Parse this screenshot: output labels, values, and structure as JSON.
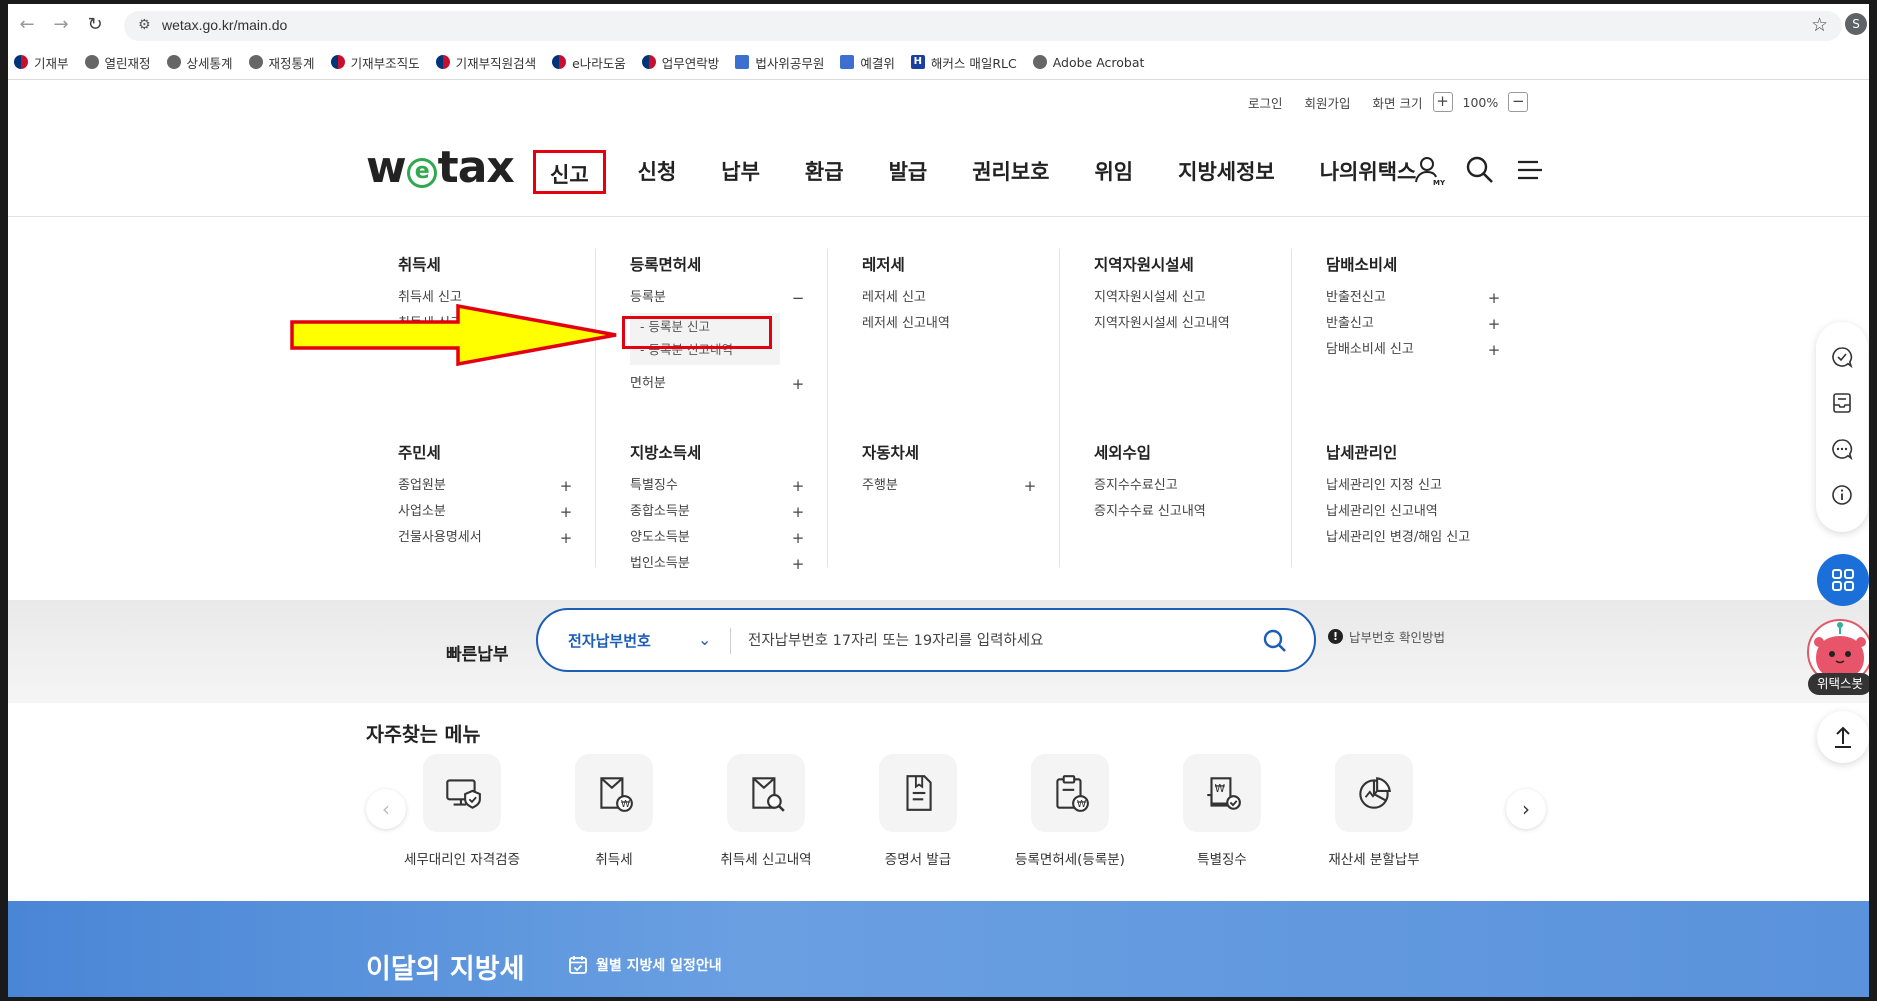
{
  "browser": {
    "url": "wetax.go.kr/main.do",
    "profile_initial": "S",
    "bookmarks": [
      {
        "label": "기재부",
        "icon": "gov-emblem-icon"
      },
      {
        "label": "열린재정",
        "icon": "globe-icon"
      },
      {
        "label": "상세통계",
        "icon": "globe-icon"
      },
      {
        "label": "재정통계",
        "icon": "globe-icon"
      },
      {
        "label": "기재부조직도",
        "icon": "gov-emblem-icon"
      },
      {
        "label": "기재부직원검색",
        "icon": "gov-emblem-icon"
      },
      {
        "label": "e나라도움",
        "icon": "gov-emblem-icon"
      },
      {
        "label": "업무연락방",
        "icon": "gov-emblem-icon"
      },
      {
        "label": "법사위공무원",
        "icon": "building-icon"
      },
      {
        "label": "예결위",
        "icon": "building-icon"
      },
      {
        "label": "해커스 매일RLC",
        "icon": "hackers-icon"
      },
      {
        "label": "Adobe Acrobat",
        "icon": "globe-icon"
      }
    ]
  },
  "util": {
    "login": "로그인",
    "signup": "회원가입",
    "zoom_label": "화면 크기",
    "zoom_plus": "+",
    "zoom_value": "100%",
    "zoom_minus": "−"
  },
  "logo": {
    "w": "w",
    "e": "e",
    "rest": "tax"
  },
  "gnb": [
    "신고",
    "신청",
    "납부",
    "환급",
    "발급",
    "권리보호",
    "위임",
    "지방세정보",
    "나의위택스"
  ],
  "mega": {
    "row1": [
      {
        "title": "취득세",
        "items": [
          {
            "label": "취득세 신고",
            "pm": ""
          },
          {
            "label": "취득세 신고내역",
            "pm": ""
          }
        ]
      },
      {
        "title": "등록면허세",
        "items": [
          {
            "label": "등록분",
            "pm": "−"
          }
        ],
        "sub": [
          "- 등록분 신고",
          "- 등록분 신고내역"
        ],
        "after": [
          {
            "label": "면허분",
            "pm": "+"
          }
        ]
      },
      {
        "title": "레저세",
        "items": [
          {
            "label": "레저세 신고",
            "pm": ""
          },
          {
            "label": "레저세 신고내역",
            "pm": ""
          }
        ]
      },
      {
        "title": "지역자원시설세",
        "items": [
          {
            "label": "지역자원시설세 신고",
            "pm": ""
          },
          {
            "label": "지역자원시설세 신고내역",
            "pm": ""
          }
        ]
      },
      {
        "title": "담배소비세",
        "items": [
          {
            "label": "반출전신고",
            "pm": "+"
          },
          {
            "label": "반출신고",
            "pm": "+"
          },
          {
            "label": "담배소비세 신고",
            "pm": "+"
          }
        ]
      }
    ],
    "row2": [
      {
        "title": "주민세",
        "items": [
          {
            "label": "종업원분",
            "pm": "+"
          },
          {
            "label": "사업소분",
            "pm": "+"
          },
          {
            "label": "건물사용명세서",
            "pm": "+"
          }
        ]
      },
      {
        "title": "지방소득세",
        "items": [
          {
            "label": "특별징수",
            "pm": "+"
          },
          {
            "label": "종합소득분",
            "pm": "+"
          },
          {
            "label": "양도소득분",
            "pm": "+"
          },
          {
            "label": "법인소득분",
            "pm": "+"
          }
        ]
      },
      {
        "title": "자동차세",
        "items": [
          {
            "label": "주행분",
            "pm": "+"
          }
        ]
      },
      {
        "title": "세외수입",
        "items": [
          {
            "label": "증지수수료신고",
            "pm": ""
          },
          {
            "label": "증지수수료 신고내역",
            "pm": ""
          }
        ]
      },
      {
        "title": "납세관리인",
        "items": [
          {
            "label": "납세관리인 지정 신고",
            "pm": ""
          },
          {
            "label": "납세관리인 신고내역",
            "pm": ""
          },
          {
            "label": "납세관리인 변경/해임 신고",
            "pm": ""
          }
        ]
      }
    ]
  },
  "quick_pay": {
    "label": "빠른납부",
    "select": "전자납부번호",
    "placeholder": "전자납부번호 17자리 또는 19자리를 입력하세요",
    "help": "납부번호 확인방법"
  },
  "frequent": {
    "title": "자주찾는 메뉴",
    "items": [
      {
        "label": "세무대리인 자격검증",
        "icon": "monitor-shield-icon"
      },
      {
        "label": "취득세",
        "icon": "document-coin-icon"
      },
      {
        "label": "취득세 신고내역",
        "icon": "document-search-icon"
      },
      {
        "label": "증명서 발급",
        "icon": "certificate-icon"
      },
      {
        "label": "등록면허세(등록분)",
        "icon": "clipboard-coin-icon"
      },
      {
        "label": "특별징수",
        "icon": "invoice-check-icon"
      },
      {
        "label": "재산세 분할납부",
        "icon": "pie-chart-icon"
      }
    ]
  },
  "month": {
    "title": "이달의 지방세",
    "link": "월별 지방세 일정안내"
  },
  "bot_label": "위택스봇",
  "colors": {
    "accent": "#1b5db7",
    "highlight": "#e3000f",
    "arrow_fill": "#ffff00",
    "brand_green": "#2fa84f"
  }
}
